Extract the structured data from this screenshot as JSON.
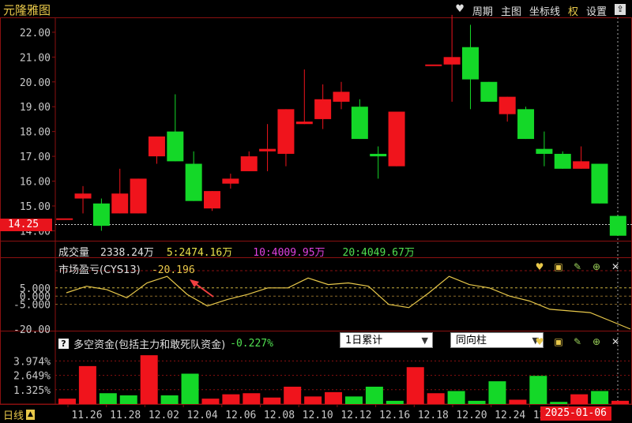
{
  "title": "元隆雅图",
  "toolbar": {
    "heart": "♥",
    "period": "周期",
    "main_chart": "主图",
    "crosshair": "坐标线",
    "rights": "权",
    "settings": "设置",
    "export": "⇪"
  },
  "colors": {
    "up": "#f0141c",
    "down": "#14d828",
    "grid": "#8a1010",
    "axis_text": "#c8c8c8",
    "ma5": "#e8e04a",
    "ma10": "#e040e0",
    "ma20": "#50e050",
    "indicator_line": "#e8c84a"
  },
  "price_axis": {
    "ticks": [
      "22.00",
      "21.00",
      "20.00",
      "19.00",
      "18.00",
      "17.00",
      "16.00",
      "15.00",
      "14.00"
    ],
    "min": 13.6,
    "max": 22.6,
    "current_price_label": "14.25",
    "current_price": 14.25
  },
  "x_axis": {
    "labels": [
      "11.26",
      "11.28",
      "12.02",
      "12.04",
      "12.06",
      "12.08",
      "12.10",
      "12.12",
      "12.16",
      "12.18",
      "12.20",
      "12.24",
      "12.26",
      "1"
    ],
    "cursor_date": "2025-01-06",
    "period_label": "日线"
  },
  "chart_data": [
    {
      "type": "candlestick",
      "title": "元隆雅图",
      "ylim": [
        13.6,
        22.6
      ],
      "candles": [
        {
          "open": 14.5,
          "close": 14.5,
          "high": 14.5,
          "low": 14.5
        },
        {
          "open": 15.3,
          "close": 15.5,
          "high": 15.8,
          "low": 14.7
        },
        {
          "open": 15.1,
          "close": 14.2,
          "high": 15.3,
          "low": 14.0
        },
        {
          "open": 14.7,
          "close": 15.5,
          "high": 16.5,
          "low": 14.7
        },
        {
          "open": 14.7,
          "close": 16.1,
          "high": 16.1,
          "low": 14.7
        },
        {
          "open": 17.0,
          "close": 17.8,
          "high": 17.8,
          "low": 16.7
        },
        {
          "open": 18.0,
          "close": 16.8,
          "high": 19.5,
          "low": 16.8
        },
        {
          "open": 16.7,
          "close": 15.2,
          "high": 17.2,
          "low": 15.2
        },
        {
          "open": 14.9,
          "close": 15.6,
          "high": 15.6,
          "low": 14.8
        },
        {
          "open": 15.9,
          "close": 16.1,
          "high": 16.3,
          "low": 15.7
        },
        {
          "open": 16.4,
          "close": 17.0,
          "high": 17.2,
          "low": 16.4
        },
        {
          "open": 17.2,
          "close": 17.3,
          "high": 18.3,
          "low": 16.4
        },
        {
          "open": 17.1,
          "close": 18.9,
          "high": 18.9,
          "low": 16.6
        },
        {
          "open": 18.3,
          "close": 18.4,
          "high": 20.5,
          "low": 18.3
        },
        {
          "open": 18.5,
          "close": 19.3,
          "high": 19.9,
          "low": 18.1
        },
        {
          "open": 19.2,
          "close": 19.6,
          "high": 20.0,
          "low": 18.9
        },
        {
          "open": 19.0,
          "close": 17.7,
          "high": 19.3,
          "low": 17.7
        },
        {
          "open": 17.1,
          "close": 17.0,
          "high": 17.4,
          "low": 16.1
        },
        {
          "open": 16.6,
          "close": 18.8,
          "high": 18.8,
          "low": 16.6
        },
        null,
        {
          "open": 20.7,
          "close": 20.7,
          "high": 20.7,
          "low": 20.7
        },
        {
          "open": 20.7,
          "close": 21.0,
          "high": 22.7,
          "low": 19.2
        },
        {
          "open": 21.4,
          "close": 20.1,
          "high": 22.3,
          "low": 18.9
        },
        {
          "open": 20.0,
          "close": 19.2,
          "high": 20.0,
          "low": 19.2
        },
        {
          "open": 18.7,
          "close": 19.4,
          "high": 19.4,
          "low": 18.4
        },
        {
          "open": 18.9,
          "close": 17.7,
          "high": 19.0,
          "low": 17.7
        },
        {
          "open": 17.3,
          "close": 17.1,
          "high": 18.0,
          "low": 16.6
        },
        {
          "open": 17.1,
          "close": 16.5,
          "high": 17.2,
          "low": 16.5
        },
        {
          "open": 16.5,
          "close": 16.8,
          "high": 17.4,
          "low": 16.5
        },
        {
          "open": 16.7,
          "close": 15.1,
          "high": 16.7,
          "low": 15.1
        },
        {
          "open": 14.6,
          "close": 13.8,
          "high": 14.6,
          "low": 13.8
        }
      ]
    },
    {
      "type": "line",
      "title": "市场盈亏(CYS13)",
      "current_value": "-20.196",
      "ticks": [
        "5.000",
        "0.000",
        "-5.000",
        "-20.00"
      ],
      "tick_values": [
        5,
        0,
        -5,
        -20
      ],
      "ylim": [
        -20.5,
        14
      ],
      "values": [
        2,
        6,
        4,
        -1,
        8,
        12,
        1,
        -6,
        -2,
        1,
        5,
        5,
        11,
        7,
        8,
        6,
        -5,
        -7,
        2,
        12,
        7,
        5,
        0,
        -3,
        -8,
        -9,
        -10,
        -15,
        -20
      ]
    },
    {
      "type": "bar",
      "title": "多空资金(包括主力和敢死队资金)",
      "current_value": "-0.227%",
      "ticks": [
        "3.974%",
        "2.649%",
        "1.325%"
      ],
      "tick_values": [
        3.974,
        2.649,
        1.325
      ],
      "ylim": [
        0,
        4.8
      ],
      "bars": [
        {
          "v": 0.5,
          "up": true
        },
        {
          "v": 3.5,
          "up": true
        },
        {
          "v": 1.0,
          "up": false
        },
        {
          "v": 0.8,
          "up": false
        },
        {
          "v": 4.5,
          "up": true
        },
        {
          "v": 0.8,
          "up": false
        },
        {
          "v": 2.8,
          "up": false
        },
        {
          "v": 0.5,
          "up": true
        },
        {
          "v": 0.9,
          "up": true
        },
        {
          "v": 1.0,
          "up": true
        },
        {
          "v": 0.6,
          "up": true
        },
        {
          "v": 1.6,
          "up": true
        },
        {
          "v": 0.7,
          "up": true
        },
        {
          "v": 1.1,
          "up": true
        },
        {
          "v": 0.7,
          "up": false
        },
        {
          "v": 1.6,
          "up": false
        },
        {
          "v": 0.3,
          "up": false
        },
        {
          "v": 3.4,
          "up": true
        },
        {
          "v": 1.0,
          "up": true
        },
        {
          "v": 1.2,
          "up": false
        },
        {
          "v": 0.3,
          "up": false
        },
        {
          "v": 2.1,
          "up": false
        },
        {
          "v": 0.4,
          "up": true
        },
        {
          "v": 2.6,
          "up": false
        },
        {
          "v": 0.2,
          "up": false
        },
        {
          "v": 0.9,
          "up": true
        },
        {
          "v": 1.2,
          "up": false
        },
        {
          "v": 0.3,
          "up": true
        }
      ]
    }
  ],
  "volume_legend": {
    "label": "成交量",
    "value": "2338.24万",
    "ma5": "5:2474.16万",
    "ma10": "10:4009.95万",
    "ma20": "20:4049.67万"
  },
  "indicator": {
    "name": "市场盈亏(CYS13)",
    "value": "-20.196"
  },
  "money_flow": {
    "help": "?",
    "name": "多空资金(包括主力和敢死队资金)",
    "value": "-0.227%",
    "select1": "1日累计",
    "select2": "同向柱"
  },
  "panel_icons": [
    "heart-icon",
    "window-icon",
    "pin-icon",
    "zoom-icon",
    "close-icon"
  ]
}
